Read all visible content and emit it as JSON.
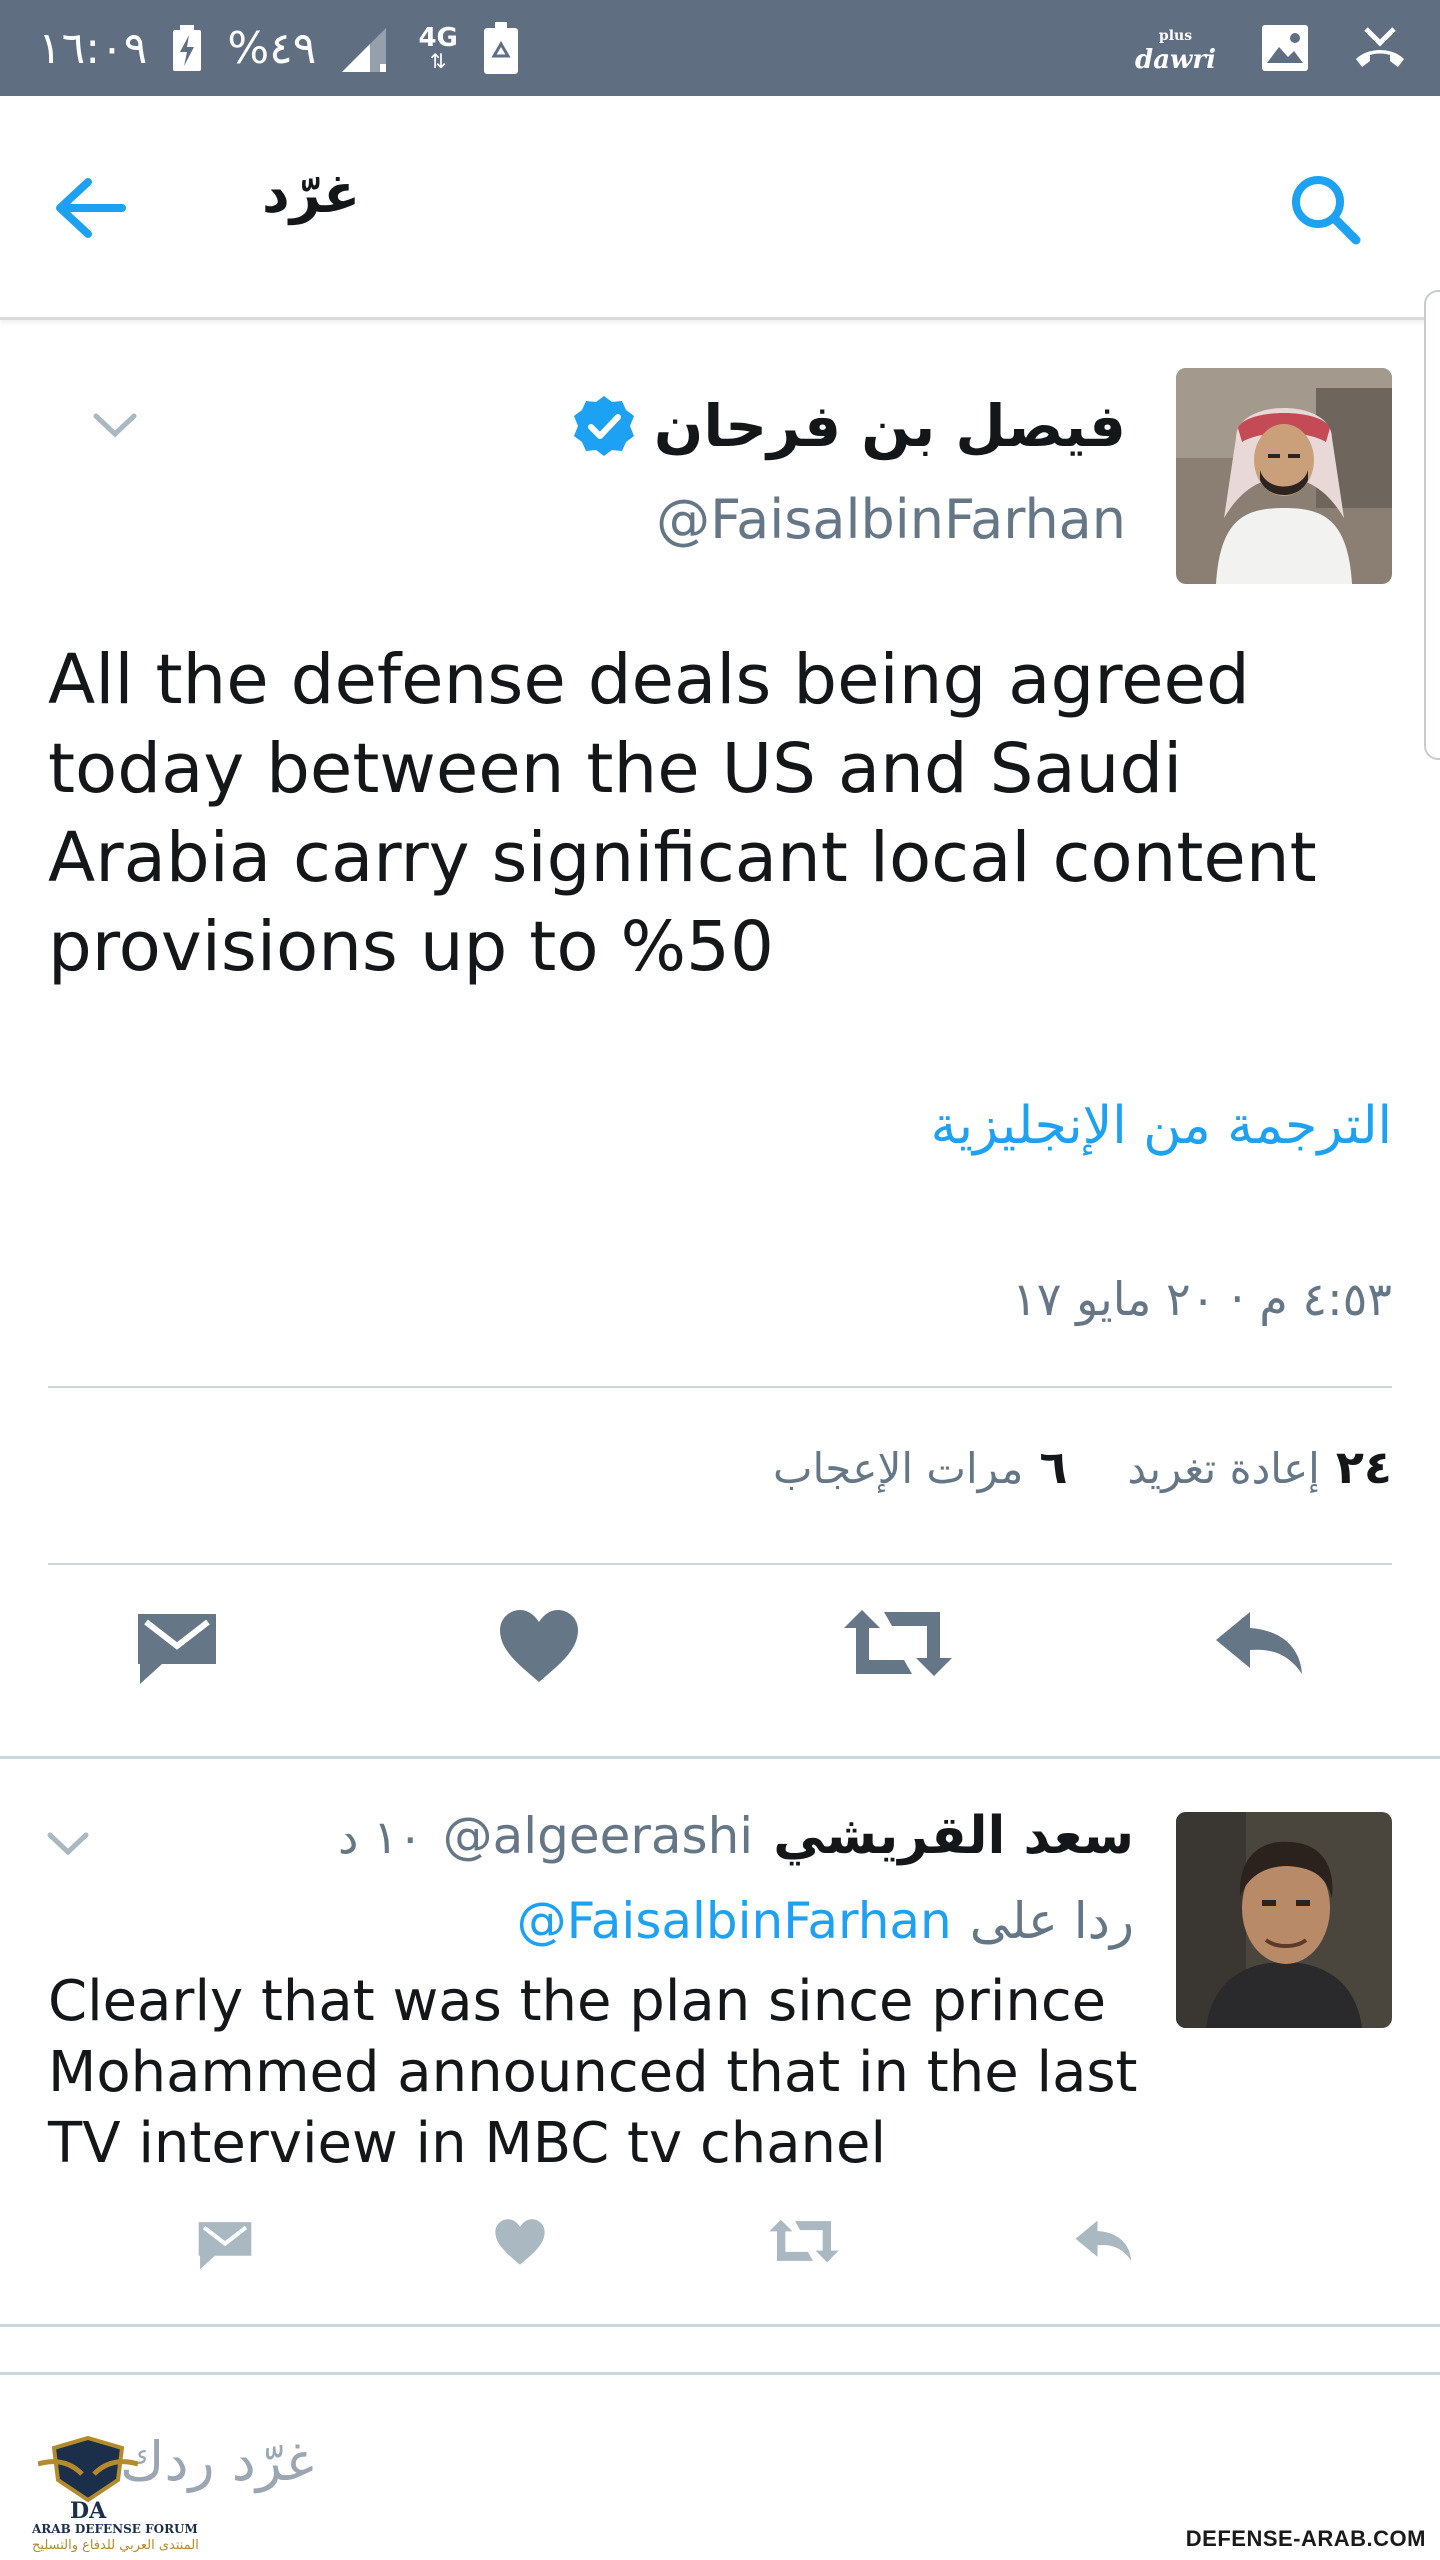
{
  "status_bar": {
    "time": "١٦:٠٩",
    "battery": "%٤٩",
    "network": "4G",
    "right_app": "dawri",
    "right_app_small": "plus"
  },
  "app_bar": {
    "title": "غرّد"
  },
  "tweet": {
    "author_name": "فيصل بن فرحان",
    "author_handle": "@FaisalbinFarhan",
    "text": "All the defense deals being agreed today between the US and Saudi Arabia carry significant local content provisions up to %50",
    "translate_label": "الترجمة من الإنجليزية",
    "timestamp": "٤:٥٣ م · ٢٠ مايو ١٧",
    "retweets_count": "٢٤",
    "retweets_label": "إعادة تغريد",
    "likes_count": "٦",
    "likes_label": "مرات الإعجاب"
  },
  "reply": {
    "author_name": "سعد القريشي",
    "author_handle": "@algeerashi",
    "time": "١٠ د",
    "reply_to_label": "ردا على",
    "reply_to_handle": "@FaisalbinFarhan",
    "text": "Clearly that was the plan since prince Mohammed announced that in the last TV interview in MBC tv chanel"
  },
  "composer": {
    "placeholder": "غرّد ردك"
  },
  "watermark": {
    "logo_mark": "DA",
    "logo_en": "ARAB DEFENSE FORUM",
    "logo_ar": "المنتدى العربي للدفاع والتسليح",
    "site": "DEFENSE-ARAB.COM"
  },
  "colors": {
    "status_bar": "#5f6e80",
    "accent": "#1da1f2",
    "icon_gray": "#657786",
    "muted_text": "#657786",
    "divider": "#ccd6dd"
  },
  "icons": {
    "back": "arrow-left-icon",
    "search": "search-icon",
    "verified": "verified-badge-icon",
    "reply": "reply-icon",
    "retweet": "retweet-icon",
    "like": "heart-icon",
    "dm": "envelope-icon"
  }
}
